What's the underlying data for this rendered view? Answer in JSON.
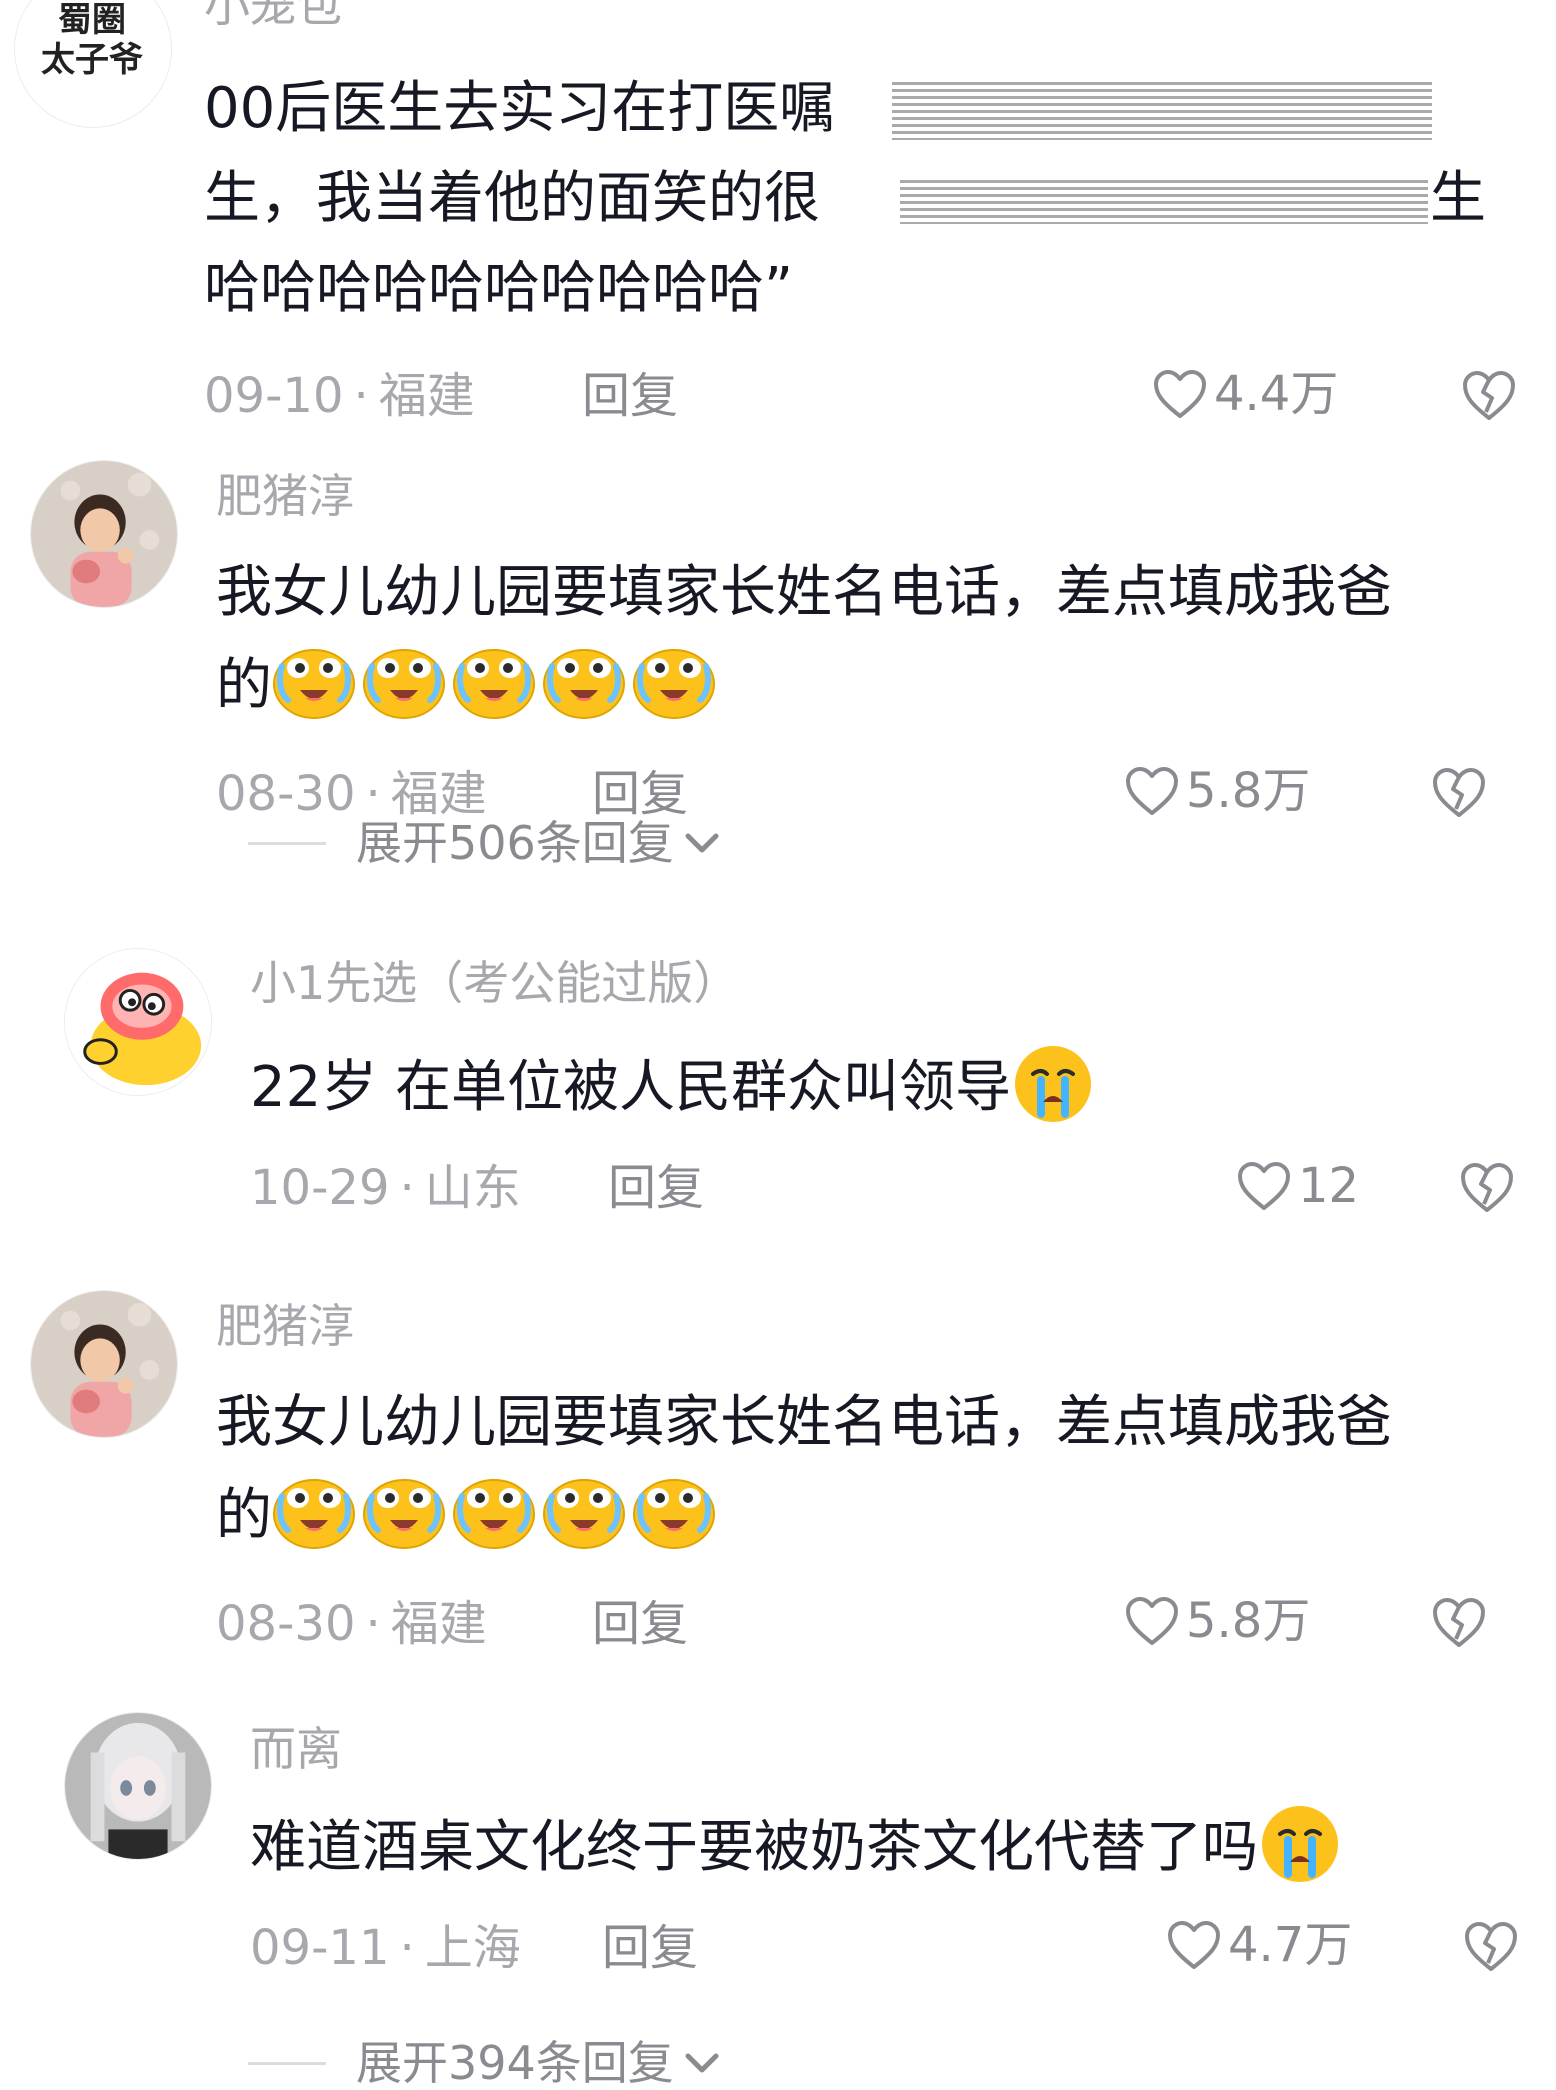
{
  "comments": [
    {
      "username": "小笼包",
      "avatar_text_1": "蜀圈",
      "avatar_text_2": "太子爷",
      "lines": [
        "00后医生去实习在打医嘱",
        "生，我当着他的面笑的很",
        "哈哈哈哈哈哈哈哈哈哈”"
      ],
      "line_2_tail": "生",
      "date": "09-10",
      "location": "福建",
      "reply_label": "回复",
      "likes": "4.4万"
    },
    {
      "username": "肥猪淳",
      "lines": [
        "我女儿幼儿园要填家长姓名电话，差点填成我爸",
        "的"
      ],
      "emoji_count": 5,
      "date": "08-30",
      "location": "福建",
      "reply_label": "回复",
      "likes": "5.8万",
      "expand_label": "展开506条回复"
    },
    {
      "username": "小1先选（考公能过版）",
      "lines": [
        "22岁 在单位被人民群众叫领导"
      ],
      "date": "10-29",
      "location": "山东",
      "reply_label": "回复",
      "likes": "12"
    },
    {
      "username": "肥猪淳",
      "lines": [
        "我女儿幼儿园要填家长姓名电话，差点填成我爸",
        "的"
      ],
      "emoji_count": 5,
      "date": "08-30",
      "location": "福建",
      "reply_label": "回复",
      "likes": "5.8万"
    },
    {
      "username": "而离",
      "lines": [
        "难道酒桌文化终于要被奶茶文化代替了吗"
      ],
      "date": "09-11",
      "location": "上海",
      "reply_label": "回复",
      "likes": "4.7万",
      "expand_label": "展开394条回复"
    }
  ],
  "meta_separator": "·",
  "icons": {
    "like": "heart-outline-icon",
    "dislike": "broken-heart-icon",
    "expand": "chevron-down-icon",
    "emoji_a": "crying-laughing-emoji",
    "emoji_b": "crying-emoji"
  },
  "colors": {
    "text": "#161823",
    "muted": "#a7a8ad",
    "action": "#8a8b91",
    "emoji_yellow": "#fcc21b"
  }
}
